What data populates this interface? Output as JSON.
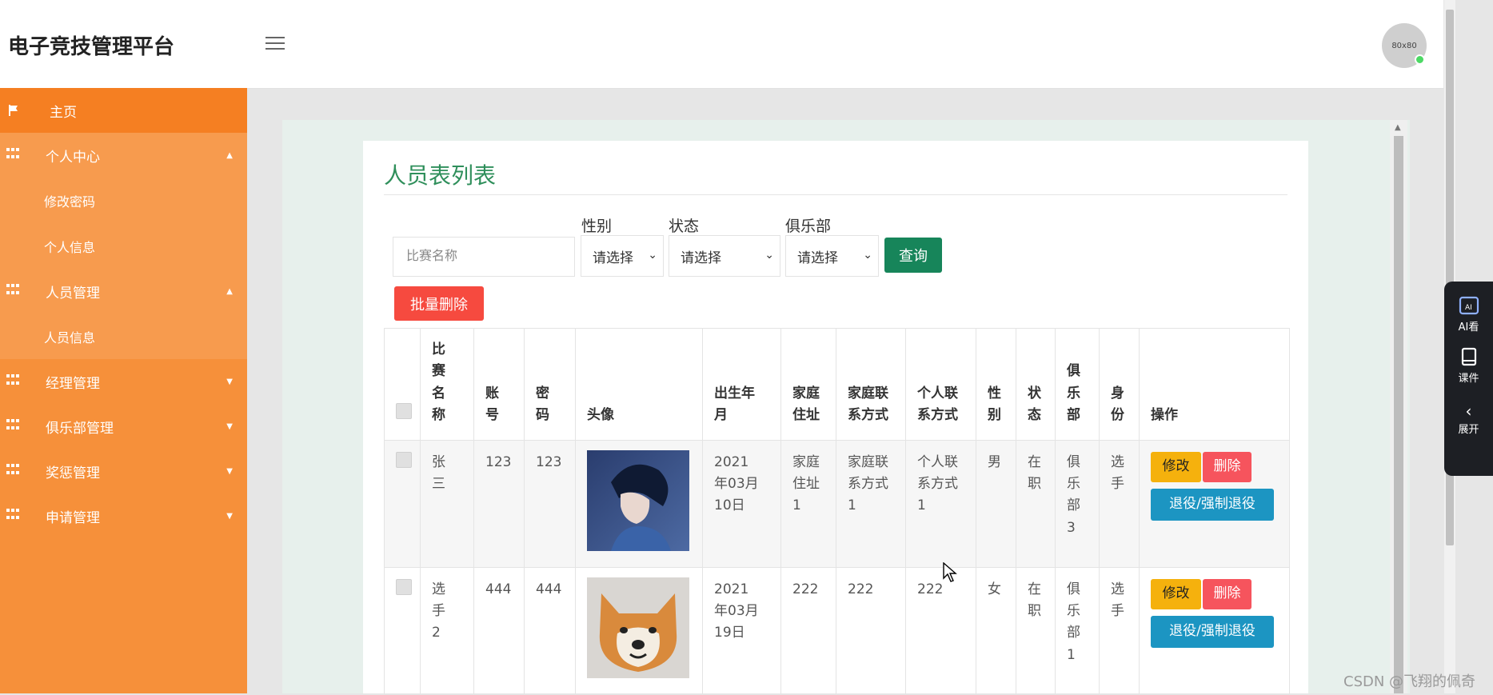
{
  "header": {
    "title": "电子竞技管理平台",
    "avatar_text": "80x80"
  },
  "sidebar": {
    "home": "主页",
    "personal": {
      "label": "个人中心",
      "items": [
        "修改密码",
        "个人信息"
      ]
    },
    "staff": {
      "label": "人员管理",
      "items": [
        "人员信息"
      ]
    },
    "manager": "经理管理",
    "club": "俱乐部管理",
    "reward": "奖惩管理",
    "apply": "申请管理"
  },
  "card": {
    "title": "人员表列表",
    "filters": {
      "search_placeholder": "比赛名称",
      "gender_label": "性别",
      "status_label": "状态",
      "club_label": "俱乐部",
      "select_placeholder": "请选择",
      "query_button": "查询",
      "batch_delete_button": "批量删除"
    },
    "table": {
      "headers": {
        "name": "比赛名称",
        "account": "账号",
        "password": "密码",
        "avatar": "头像",
        "birth": "出生年月",
        "address": "家庭住址",
        "family_contact": "家庭联系方式",
        "personal_contact": "个人联系方式",
        "gender": "性别",
        "status": "状态",
        "club": "俱乐部",
        "identity": "身份",
        "action": "操作"
      },
      "rows": [
        {
          "name": "张三",
          "account": "123",
          "password": "123",
          "birth": "2021年03月10日",
          "address": "家庭住址1",
          "family_contact": "家庭联系方式1",
          "personal_contact": "个人联系方式1",
          "gender": "男",
          "status": "在职",
          "club": "俱乐部3",
          "identity": "选手"
        },
        {
          "name": "选手2",
          "account": "444",
          "password": "444",
          "birth": "2021年03月19日",
          "address": "222",
          "family_contact": "222",
          "personal_contact": "222",
          "gender": "女",
          "status": "在职",
          "club": "俱乐部1",
          "identity": "选手"
        }
      ],
      "actions": {
        "edit": "修改",
        "delete": "删除",
        "retire": "退役/强制退役"
      }
    }
  },
  "side_widget": {
    "ai": "AI看",
    "courseware": "课件",
    "expand": "展开"
  },
  "watermark": "CSDN @飞翔的佩奇",
  "colors": {
    "sidebar": "#f6903a",
    "title_green": "#2f8f5b",
    "query_green": "#17855a",
    "danger": "#f64a3f",
    "warning": "#f5b10d",
    "info": "#1c95c2"
  }
}
